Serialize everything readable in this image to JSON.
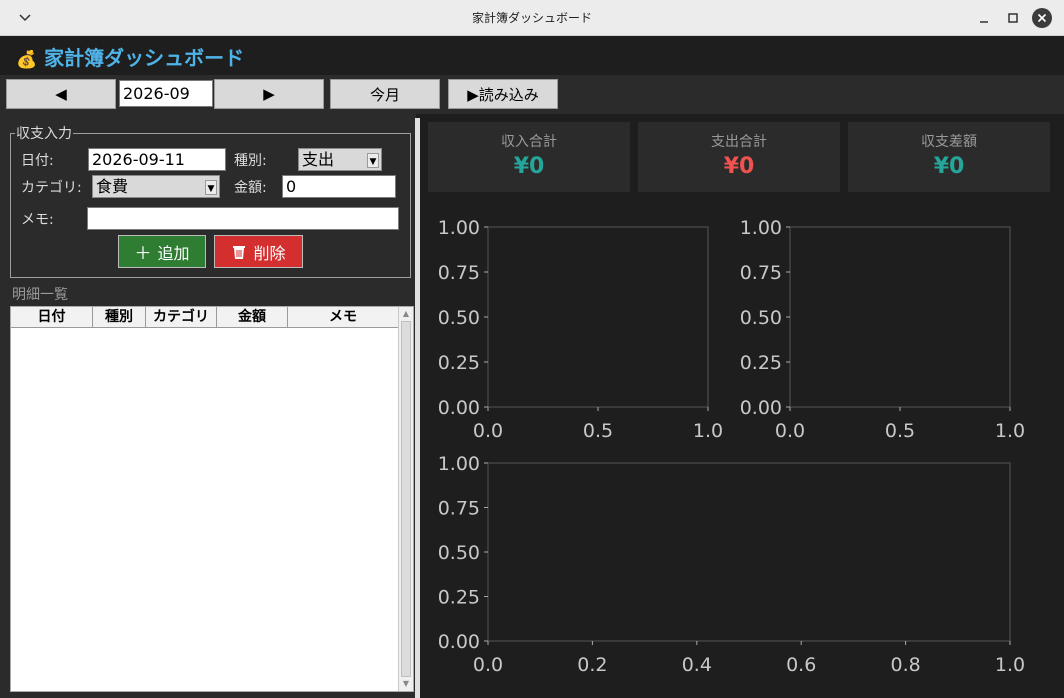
{
  "window": {
    "title": "家計簿ダッシュボード"
  },
  "app": {
    "title": "家計簿ダッシュボード",
    "accent": "#4fb3e8",
    "icon": "money-bag-icon"
  },
  "toolbar": {
    "prev_label": "◀",
    "month_value": "2026-09",
    "next_label": "▶",
    "today_label": "今月",
    "load_label": "▶読み込み"
  },
  "entry": {
    "legend": "収支入力",
    "date_label": "日付:",
    "date_value": "2026-09-11",
    "type_label": "種別:",
    "type_value": "支出",
    "category_label": "カテゴリ:",
    "category_value": "食費",
    "amount_label": "金額:",
    "amount_value": "0",
    "memo_label": "メモ:",
    "memo_value": "",
    "add_label": "追加",
    "delete_label": "削除",
    "add_color": "#2e7d32",
    "delete_color": "#d32f2f"
  },
  "list": {
    "title": "明細一覧",
    "columns": [
      "日付",
      "種別",
      "カテゴリ",
      "金額",
      "メモ"
    ]
  },
  "summary": {
    "income_label": "収入合計",
    "income_value": "¥0",
    "income_color": "#26a69a",
    "expense_label": "支出合計",
    "expense_value": "¥0",
    "expense_color": "#ef5350",
    "balance_label": "収支差額",
    "balance_value": "¥0",
    "balance_color": "#26a69a"
  },
  "chart_data": [
    {
      "type": "line",
      "title": "",
      "xlim": [
        0,
        1
      ],
      "ylim": [
        0,
        1
      ],
      "xticks": [
        "0.0",
        "0.5",
        "1.0"
      ],
      "yticks": [
        "0.00",
        "0.25",
        "0.50",
        "0.75",
        "1.00"
      ],
      "series": []
    },
    {
      "type": "line",
      "title": "",
      "xlim": [
        0,
        1
      ],
      "ylim": [
        0,
        1
      ],
      "xticks": [
        "0.0",
        "0.5",
        "1.0"
      ],
      "yticks": [
        "0.00",
        "0.25",
        "0.50",
        "0.75",
        "1.00"
      ],
      "series": []
    },
    {
      "type": "line",
      "title": "",
      "xlim": [
        0,
        1
      ],
      "ylim": [
        0,
        1
      ],
      "xticks": [
        "0.0",
        "0.2",
        "0.4",
        "0.6",
        "0.8",
        "1.0"
      ],
      "yticks": [
        "0.00",
        "0.25",
        "0.50",
        "0.75",
        "1.00"
      ],
      "series": []
    }
  ]
}
